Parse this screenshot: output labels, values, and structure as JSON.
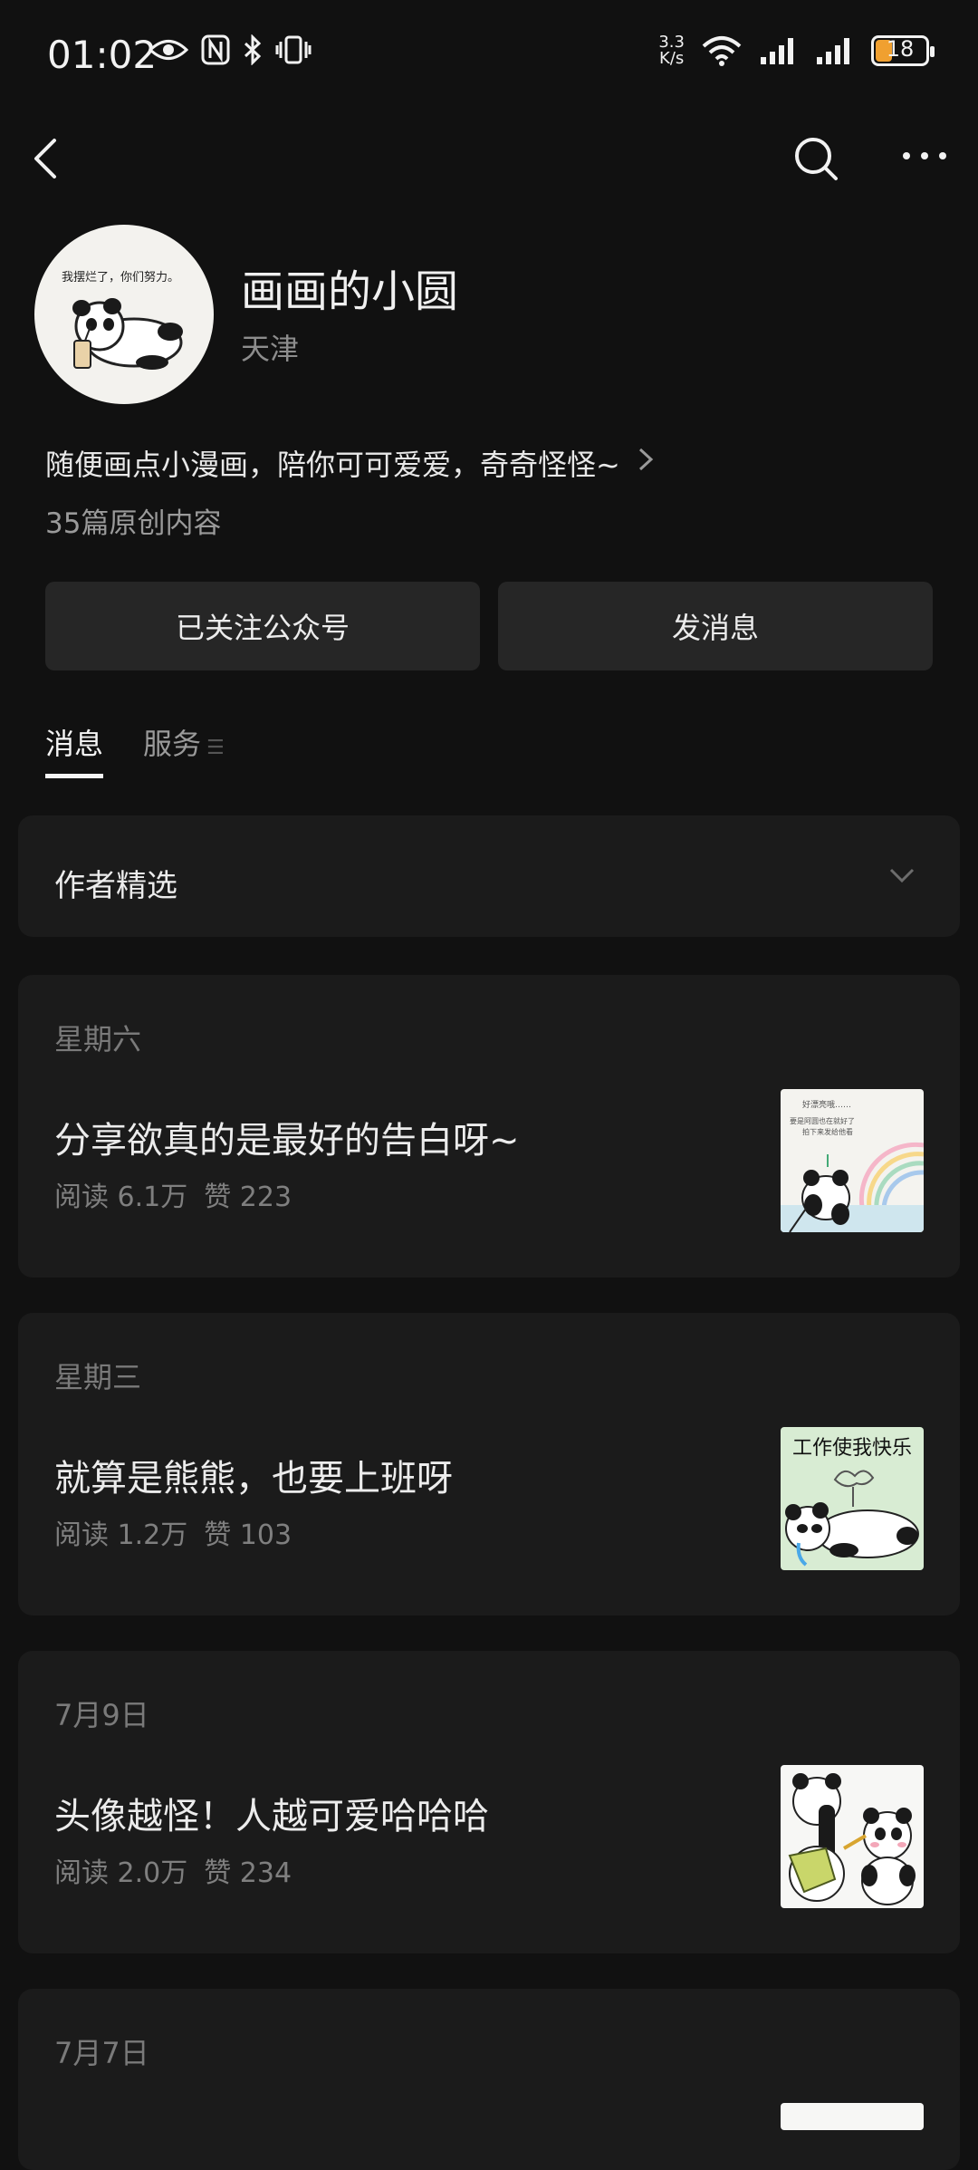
{
  "status_bar": {
    "time": "01:02",
    "net_speed_top": "3.3",
    "net_speed_bottom": "K/s",
    "battery": "18"
  },
  "profile": {
    "avatar_text": "我摆烂了，你们努力。",
    "name": "画画的小圆",
    "location": "天津",
    "bio": "随便画点小漫画，陪你可可爱爱，奇奇怪怪~",
    "original_count": "35篇原创内容"
  },
  "buttons": {
    "follow": "已关注公众号",
    "message": "发消息"
  },
  "tabs": [
    {
      "label": "消息"
    },
    {
      "label": "服务"
    }
  ],
  "picks": {
    "label": "作者精选"
  },
  "articles": [
    {
      "date": "星期六",
      "title": "分享欲真的是最好的告白呀~",
      "reads": "阅读 6.1万",
      "likes": "赞 223",
      "thumb_text_top": "好漂亮哦……",
      "thumb_text_mid": "要是阿圆也在就好了",
      "thumb_text_bottom": "拍下来发给他看"
    },
    {
      "date": "星期三",
      "title": "就算是熊熊，也要上班呀",
      "reads": "阅读 1.2万",
      "likes": "赞 103",
      "thumb_text_top": "工作使我快乐"
    },
    {
      "date": "7月9日",
      "title": "头像越怪！人越可爱哈哈哈",
      "reads": "阅读 2.0万",
      "likes": "赞 234"
    },
    {
      "date": "7月7日"
    }
  ]
}
